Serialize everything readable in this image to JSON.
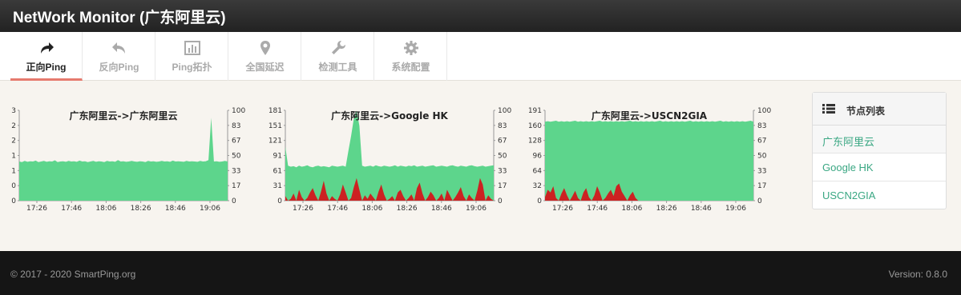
{
  "app": {
    "title": "NetWork Monitor (广东阿里云)"
  },
  "tabs": [
    {
      "label": "正向Ping",
      "icon": "share-arrow-icon",
      "active": true
    },
    {
      "label": "反向Ping",
      "icon": "reply-arrow-icon",
      "active": false
    },
    {
      "label": "Ping拓扑",
      "icon": "bar-chart-icon",
      "active": false
    },
    {
      "label": "全国延迟",
      "icon": "map-marker-icon",
      "active": false
    },
    {
      "label": "检测工具",
      "icon": "wrench-icon",
      "active": false
    },
    {
      "label": "系统配置",
      "icon": "gear-icon",
      "active": false
    }
  ],
  "colors": {
    "latency_fill": "#5dd58c",
    "loss_fill": "#cc2222",
    "active_tab_underline": "#e67a6e",
    "link": "#3aa783"
  },
  "chart_data": [
    {
      "type": "area",
      "title": "广东阿里云->广东阿里云",
      "left_axis": {
        "ticks": [
          0,
          0,
          1,
          1,
          2,
          2,
          3
        ],
        "ylim": [
          0,
          3
        ]
      },
      "right_axis": {
        "ticks": [
          0,
          17,
          33,
          50,
          67,
          83,
          100
        ],
        "ylim": [
          0,
          100
        ]
      },
      "xticks": [
        "17:26",
        "17:46",
        "18:06",
        "18:26",
        "18:46",
        "19:06"
      ],
      "series": [
        {
          "values": [
            1.3,
            1.28,
            1.32,
            1.29,
            1.31,
            1.3,
            1.33,
            1.28,
            1.3,
            1.32,
            1.29,
            1.31,
            1.3,
            1.34,
            1.28,
            1.3,
            1.31,
            1.29,
            1.32,
            1.3,
            1.31,
            1.29,
            1.33,
            1.3,
            1.31,
            1.28,
            1.3,
            1.32,
            1.29,
            1.31,
            1.3,
            1.28,
            1.32,
            1.3,
            1.31,
            1.29,
            1.35,
            1.3,
            1.31,
            1.29,
            1.3,
            1.32,
            1.3,
            1.29,
            1.31,
            1.3,
            1.28,
            1.32,
            1.3,
            1.31,
            1.29,
            1.3,
            1.32,
            1.3,
            1.31,
            1.29,
            1.33,
            1.3,
            1.31,
            1.3,
            1.29,
            1.32,
            1.3,
            1.31,
            1.3,
            1.29,
            1.32,
            1.3,
            1.31,
            1.35,
            2.75,
            1.3,
            1.31,
            1.29,
            1.3,
            1.32,
            1.3
          ]
        },
        {
          "values": []
        }
      ]
    },
    {
      "type": "area",
      "title": "广东阿里云->Google HK",
      "left_axis": {
        "ticks": [
          0,
          31,
          61,
          91,
          121,
          151,
          181
        ],
        "ylim": [
          0,
          181
        ]
      },
      "right_axis": {
        "ticks": [
          0,
          17,
          33,
          50,
          67,
          83,
          100
        ],
        "ylim": [
          0,
          100
        ]
      },
      "xticks": [
        "17:26",
        "17:46",
        "18:06",
        "18:26",
        "18:46",
        "19:06"
      ],
      "series": [
        {
          "values": [
            108,
            70,
            68,
            69,
            67,
            70,
            68,
            69,
            71,
            68,
            67,
            69,
            70,
            68,
            69,
            68,
            67,
            70,
            69,
            68,
            69,
            70,
            68,
            100,
            130,
            165,
            180,
            150,
            70,
            68,
            69,
            70,
            68,
            71,
            69,
            68,
            70,
            69,
            68,
            69,
            71,
            68,
            70,
            69,
            68,
            70,
            69,
            71,
            68,
            69,
            70,
            68,
            69,
            70,
            71,
            68,
            69,
            70,
            69,
            68,
            70,
            71,
            69,
            68,
            70,
            69,
            68,
            70,
            71,
            69,
            68,
            69,
            70,
            68,
            69,
            70,
            71
          ]
        },
        {
          "values": [
            5,
            0,
            2,
            8,
            0,
            12,
            4,
            0,
            3,
            9,
            14,
            6,
            0,
            10,
            22,
            8,
            0,
            5,
            2,
            0,
            7,
            18,
            9,
            0,
            3,
            15,
            25,
            12,
            0,
            6,
            2,
            8,
            4,
            0,
            10,
            18,
            7,
            0,
            2,
            5,
            0,
            9,
            12,
            5,
            0,
            3,
            7,
            0,
            14,
            20,
            8,
            0,
            4,
            10,
            6,
            0,
            3,
            8,
            0,
            12,
            6,
            0,
            4,
            9,
            15,
            5,
            0,
            7,
            3,
            0,
            11,
            25,
            18,
            0,
            6,
            2,
            0
          ]
        }
      ]
    },
    {
      "type": "area",
      "title": "广东阿里云->USCN2GIA",
      "left_axis": {
        "ticks": [
          0,
          32,
          64,
          96,
          128,
          160,
          191
        ],
        "ylim": [
          0,
          191
        ]
      },
      "right_axis": {
        "ticks": [
          0,
          17,
          33,
          50,
          67,
          83,
          100
        ],
        "ylim": [
          0,
          100
        ]
      },
      "xticks": [
        "17:26",
        "17:46",
        "18:06",
        "18:26",
        "18:46",
        "19:06"
      ],
      "series": [
        {
          "values": [
            167,
            168,
            167,
            168,
            169,
            167,
            168,
            167,
            168,
            167,
            168,
            169,
            167,
            168,
            167,
            168,
            167,
            168,
            167,
            168,
            169,
            167,
            168,
            167,
            168,
            167,
            168,
            167,
            168,
            167,
            168,
            169,
            167,
            168,
            167,
            168,
            167,
            168,
            167,
            168,
            167,
            168,
            169,
            167,
            168,
            167,
            168,
            167,
            168,
            167,
            168,
            167,
            168,
            169,
            167,
            168,
            167,
            168,
            167,
            168,
            167,
            168,
            167,
            168,
            169,
            167,
            168,
            167,
            168,
            167,
            168,
            167,
            168,
            167,
            168,
            169,
            167
          ]
        },
        {
          "values": [
            4,
            12,
            9,
            16,
            3,
            0,
            8,
            14,
            6,
            0,
            5,
            11,
            3,
            0,
            9,
            14,
            4,
            0,
            6,
            16,
            9,
            0,
            3,
            8,
            12,
            5,
            16,
            19,
            10,
            5,
            0,
            6,
            10,
            3,
            0,
            0,
            0,
            0,
            0,
            0,
            0,
            0,
            0,
            0,
            0,
            0,
            0,
            0,
            0,
            0,
            0,
            0,
            0,
            0,
            0,
            0,
            0,
            0,
            0,
            0,
            0,
            0,
            0,
            0,
            0,
            0,
            0,
            0,
            0,
            0,
            0,
            0,
            0,
            0,
            0,
            0,
            0
          ]
        }
      ]
    }
  ],
  "node_panel": {
    "title": "节点列表",
    "icon": "list-icon",
    "items": [
      "广东阿里云",
      "Google HK",
      "USCN2GIA"
    ]
  },
  "footer": {
    "copyright": "© 2017 - 2020 SmartPing.org",
    "version": "Version: 0.8.0"
  }
}
